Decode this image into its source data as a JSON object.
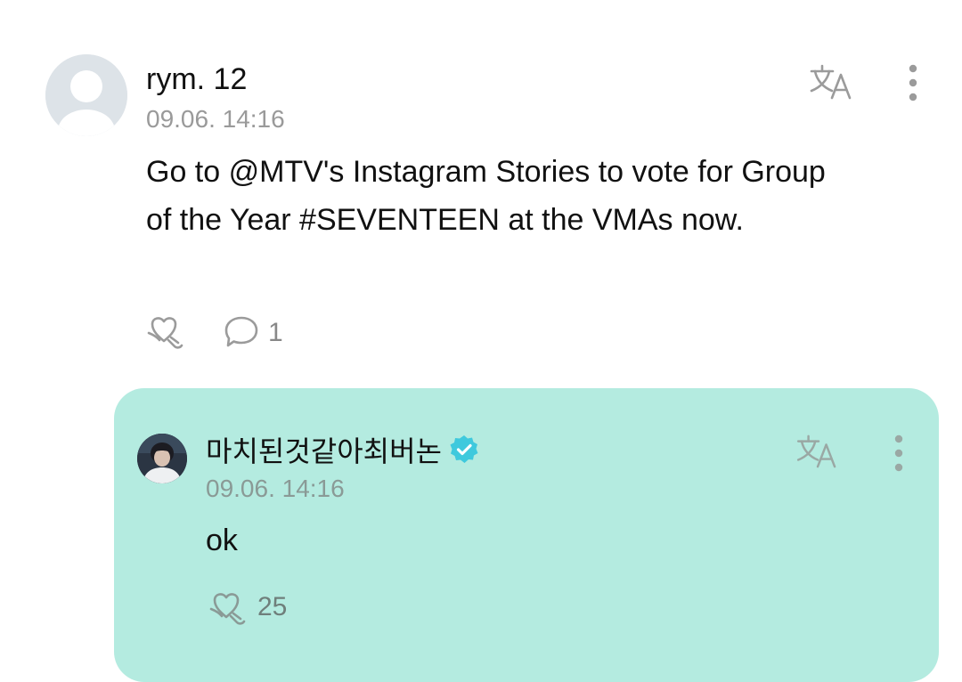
{
  "post": {
    "username": "rym. 12",
    "timestamp": "09.06. 14:16",
    "body": "Go to @MTV's Instagram Stories to vote for Group of the Year #SEVENTEEN at the VMAs now.",
    "comment_count": "1",
    "icons": {
      "translate": "translate-icon",
      "more": "more-vertical-icon",
      "like": "heart-hand-icon",
      "comment": "speech-bubble-icon"
    }
  },
  "reply": {
    "username": "마치된것같아최버논",
    "timestamp": "09.06. 14:16",
    "body": "ok",
    "like_count": "25",
    "verified": true,
    "icons": {
      "verified": "verified-badge-icon",
      "translate": "translate-icon",
      "more": "more-vertical-icon",
      "like": "heart-hand-icon"
    }
  },
  "colors": {
    "reply_background": "#b4ebe0",
    "verified_badge": "#3fc9dd",
    "muted_text": "#9a9a9a",
    "icon_gray": "#9b9b9b"
  }
}
